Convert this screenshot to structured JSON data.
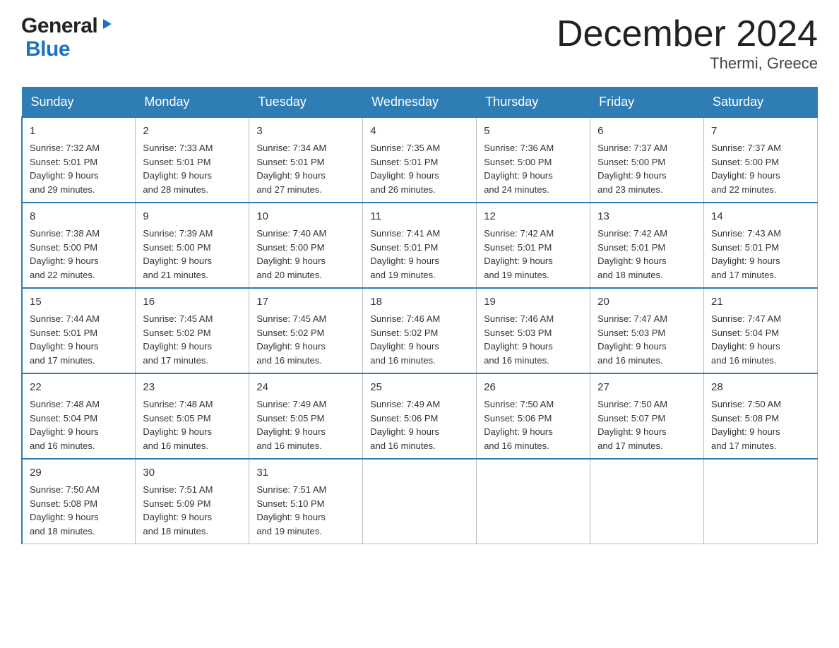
{
  "logo": {
    "general": "General",
    "blue": "Blue"
  },
  "title": "December 2024",
  "subtitle": "Thermi, Greece",
  "weekdays": [
    "Sunday",
    "Monday",
    "Tuesday",
    "Wednesday",
    "Thursday",
    "Friday",
    "Saturday"
  ],
  "weeks": [
    [
      {
        "day": "1",
        "sunrise": "7:32 AM",
        "sunset": "5:01 PM",
        "daylight": "9 hours and 29 minutes."
      },
      {
        "day": "2",
        "sunrise": "7:33 AM",
        "sunset": "5:01 PM",
        "daylight": "9 hours and 28 minutes."
      },
      {
        "day": "3",
        "sunrise": "7:34 AM",
        "sunset": "5:01 PM",
        "daylight": "9 hours and 27 minutes."
      },
      {
        "day": "4",
        "sunrise": "7:35 AM",
        "sunset": "5:01 PM",
        "daylight": "9 hours and 26 minutes."
      },
      {
        "day": "5",
        "sunrise": "7:36 AM",
        "sunset": "5:00 PM",
        "daylight": "9 hours and 24 minutes."
      },
      {
        "day": "6",
        "sunrise": "7:37 AM",
        "sunset": "5:00 PM",
        "daylight": "9 hours and 23 minutes."
      },
      {
        "day": "7",
        "sunrise": "7:37 AM",
        "sunset": "5:00 PM",
        "daylight": "9 hours and 22 minutes."
      }
    ],
    [
      {
        "day": "8",
        "sunrise": "7:38 AM",
        "sunset": "5:00 PM",
        "daylight": "9 hours and 22 minutes."
      },
      {
        "day": "9",
        "sunrise": "7:39 AM",
        "sunset": "5:00 PM",
        "daylight": "9 hours and 21 minutes."
      },
      {
        "day": "10",
        "sunrise": "7:40 AM",
        "sunset": "5:00 PM",
        "daylight": "9 hours and 20 minutes."
      },
      {
        "day": "11",
        "sunrise": "7:41 AM",
        "sunset": "5:01 PM",
        "daylight": "9 hours and 19 minutes."
      },
      {
        "day": "12",
        "sunrise": "7:42 AM",
        "sunset": "5:01 PM",
        "daylight": "9 hours and 19 minutes."
      },
      {
        "day": "13",
        "sunrise": "7:42 AM",
        "sunset": "5:01 PM",
        "daylight": "9 hours and 18 minutes."
      },
      {
        "day": "14",
        "sunrise": "7:43 AM",
        "sunset": "5:01 PM",
        "daylight": "9 hours and 17 minutes."
      }
    ],
    [
      {
        "day": "15",
        "sunrise": "7:44 AM",
        "sunset": "5:01 PM",
        "daylight": "9 hours and 17 minutes."
      },
      {
        "day": "16",
        "sunrise": "7:45 AM",
        "sunset": "5:02 PM",
        "daylight": "9 hours and 17 minutes."
      },
      {
        "day": "17",
        "sunrise": "7:45 AM",
        "sunset": "5:02 PM",
        "daylight": "9 hours and 16 minutes."
      },
      {
        "day": "18",
        "sunrise": "7:46 AM",
        "sunset": "5:02 PM",
        "daylight": "9 hours and 16 minutes."
      },
      {
        "day": "19",
        "sunrise": "7:46 AM",
        "sunset": "5:03 PM",
        "daylight": "9 hours and 16 minutes."
      },
      {
        "day": "20",
        "sunrise": "7:47 AM",
        "sunset": "5:03 PM",
        "daylight": "9 hours and 16 minutes."
      },
      {
        "day": "21",
        "sunrise": "7:47 AM",
        "sunset": "5:04 PM",
        "daylight": "9 hours and 16 minutes."
      }
    ],
    [
      {
        "day": "22",
        "sunrise": "7:48 AM",
        "sunset": "5:04 PM",
        "daylight": "9 hours and 16 minutes."
      },
      {
        "day": "23",
        "sunrise": "7:48 AM",
        "sunset": "5:05 PM",
        "daylight": "9 hours and 16 minutes."
      },
      {
        "day": "24",
        "sunrise": "7:49 AM",
        "sunset": "5:05 PM",
        "daylight": "9 hours and 16 minutes."
      },
      {
        "day": "25",
        "sunrise": "7:49 AM",
        "sunset": "5:06 PM",
        "daylight": "9 hours and 16 minutes."
      },
      {
        "day": "26",
        "sunrise": "7:50 AM",
        "sunset": "5:06 PM",
        "daylight": "9 hours and 16 minutes."
      },
      {
        "day": "27",
        "sunrise": "7:50 AM",
        "sunset": "5:07 PM",
        "daylight": "9 hours and 17 minutes."
      },
      {
        "day": "28",
        "sunrise": "7:50 AM",
        "sunset": "5:08 PM",
        "daylight": "9 hours and 17 minutes."
      }
    ],
    [
      {
        "day": "29",
        "sunrise": "7:50 AM",
        "sunset": "5:08 PM",
        "daylight": "9 hours and 18 minutes."
      },
      {
        "day": "30",
        "sunrise": "7:51 AM",
        "sunset": "5:09 PM",
        "daylight": "9 hours and 18 minutes."
      },
      {
        "day": "31",
        "sunrise": "7:51 AM",
        "sunset": "5:10 PM",
        "daylight": "9 hours and 19 minutes."
      },
      null,
      null,
      null,
      null
    ]
  ],
  "labels": {
    "sunrise": "Sunrise:",
    "sunset": "Sunset:",
    "daylight": "Daylight:"
  }
}
